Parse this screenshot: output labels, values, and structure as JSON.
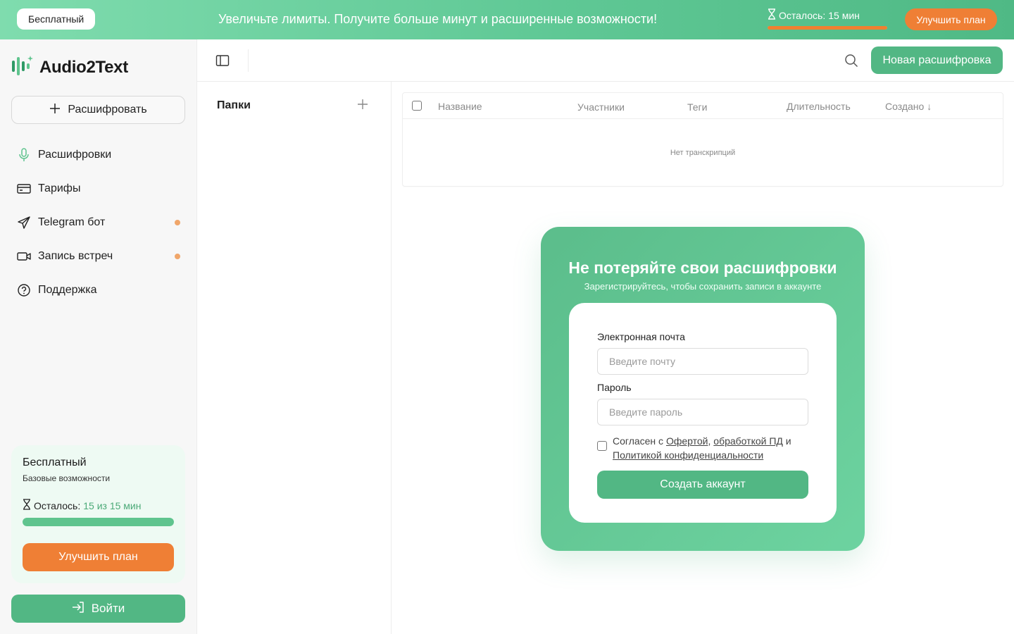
{
  "banner": {
    "plan_badge": "Бесплатный",
    "promo_text": "Увеличьте лимиты. Получите больше минут и расширенные возможности!",
    "remaining_label": "Осталось:",
    "remaining_value": "15 мин",
    "remaining_progress": 1.0,
    "upgrade_label": "Улучшить план"
  },
  "sidebar": {
    "app_name": "Audio2Text",
    "transcribe_label": "Расшифровать",
    "items": [
      {
        "label": "Расшифровки",
        "icon": "mic-icon",
        "has_dot": false
      },
      {
        "label": "Тарифы",
        "icon": "card-icon",
        "has_dot": false
      },
      {
        "label": "Telegram бот",
        "icon": "send-icon",
        "has_dot": true
      },
      {
        "label": "Запись встреч",
        "icon": "video-icon",
        "has_dot": true
      },
      {
        "label": "Поддержка",
        "icon": "help-icon",
        "has_dot": false
      }
    ],
    "plan": {
      "name": "Бесплатный",
      "description": "Базовые возможности",
      "remaining_label": "Осталось:",
      "remaining_value": "15 из 15 мин",
      "progress": 1.0,
      "upgrade_label": "Улучшить план"
    },
    "login_label": "Войти"
  },
  "header": {
    "new_transcription_label": "Новая расшифровка"
  },
  "folders": {
    "title": "Папки"
  },
  "table": {
    "columns": [
      "Название",
      "Участники",
      "Теги",
      "Длительность",
      "Создано ↓"
    ],
    "empty_text": "Нет транскрипций"
  },
  "signup": {
    "title": "Не потеряйте свои расшифровки",
    "subtitle": "Зарегистрируйтесь, чтобы сохранить записи в аккаунте",
    "email_label": "Электронная почта",
    "email_placeholder": "Введите почту",
    "password_label": "Пароль",
    "password_placeholder": "Введите пароль",
    "agree_prefix": "Согласен с ",
    "agree_offer": "Офертой",
    "agree_comma": ", ",
    "agree_pd": "обработкой ПД",
    "agree_and": " и",
    "agree_privacy": "Политикой конфиденциальности",
    "submit_label": "Создать аккаунт"
  },
  "colors": {
    "accent_green": "#52b784",
    "accent_orange": "#ef7f35"
  }
}
